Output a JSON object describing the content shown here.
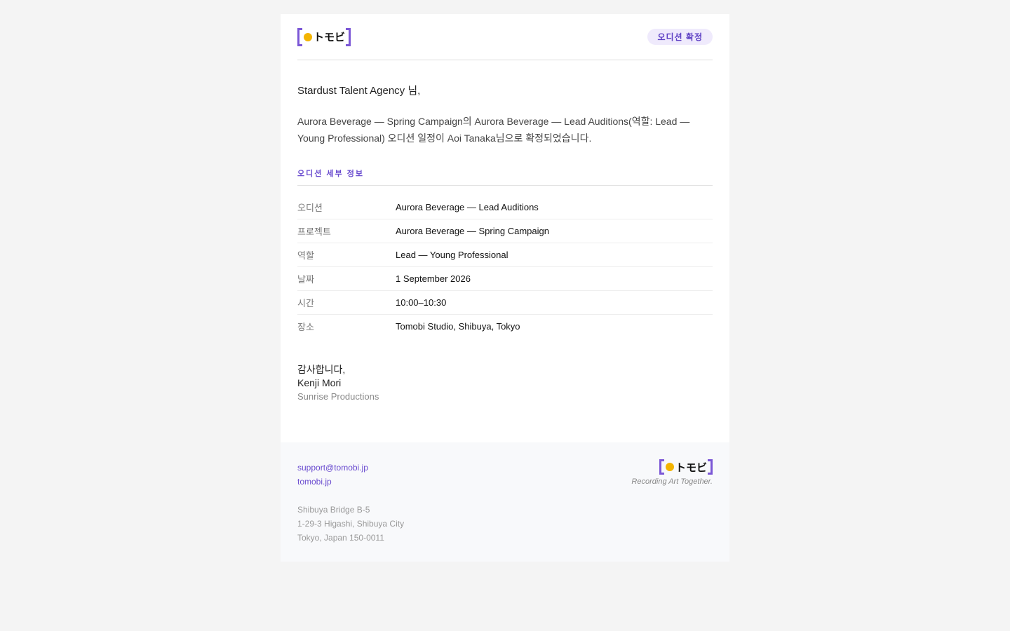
{
  "brand": {
    "logo_text": "トモビ",
    "tagline": "Recording Art Together."
  },
  "header": {
    "badge": "오디션 확정"
  },
  "email": {
    "greeting": "Stardust Talent Agency 님,",
    "body": "Aurora Beverage — Spring Campaign의 Aurora Beverage — Lead Auditions(역할: Lead — Young Professional) 오디션 일정이 Aoi Tanaka님으로 확정되었습니다.",
    "section_title": "오디션 세부 정보",
    "details": [
      {
        "label": "오디션",
        "value": "Aurora Beverage — Lead Auditions"
      },
      {
        "label": "프로젝트",
        "value": "Aurora Beverage — Spring Campaign"
      },
      {
        "label": "역할",
        "value": "Lead — Young Professional"
      },
      {
        "label": "날짜",
        "value": "1 September 2026"
      },
      {
        "label": "시간",
        "value": "10:00–10:30"
      },
      {
        "label": "장소",
        "value": "Tomobi Studio, Shibuya, Tokyo"
      }
    ],
    "signoff": {
      "thanks": "감사합니다,",
      "name": "Kenji Mori",
      "company": "Sunrise Productions"
    }
  },
  "footer": {
    "email": "support@tomobi.jp",
    "website": "tomobi.jp",
    "address": [
      "Shibuya Bridge B-5",
      "1-29-3 Higashi, Shibuya City",
      "Tokyo, Japan 150-0011"
    ]
  },
  "colors": {
    "accent": "#7b57d6",
    "dot": "#f3b400",
    "badge_bg": "#efeafc"
  }
}
